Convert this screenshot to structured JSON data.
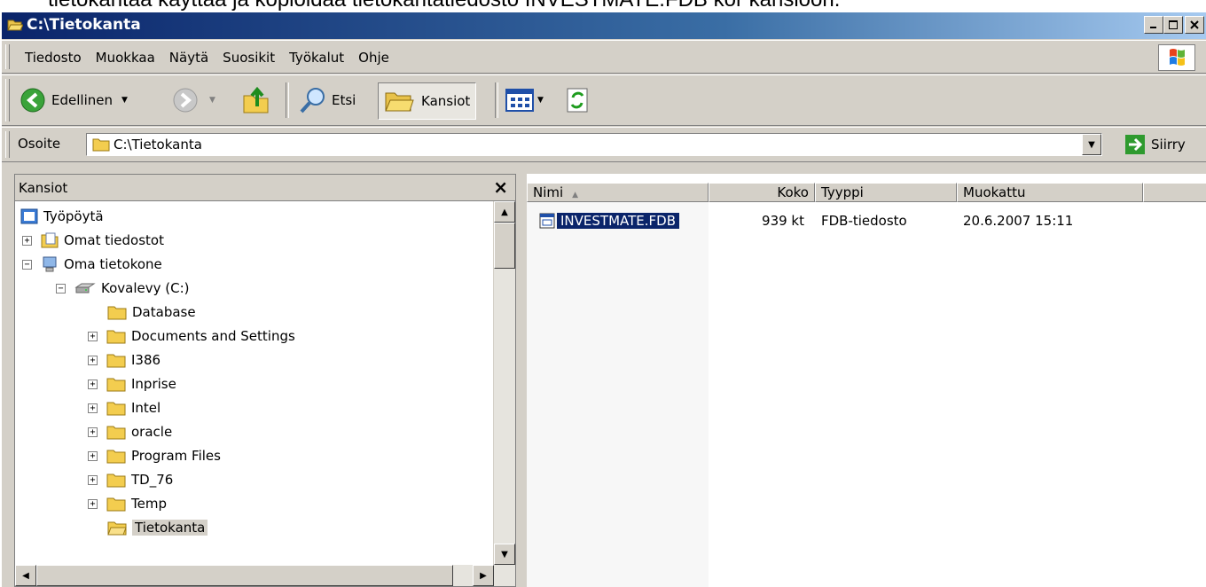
{
  "caption": "tietokantaa käyttää ja kopioidaa tietokantatiedosto INVESTMATE.FDB kor kansioon.",
  "window": {
    "title": "C:\\Tietokanta",
    "title_icon": "folder-open-icon"
  },
  "menu": [
    "Tiedosto",
    "Muokkaa",
    "Näytä",
    "Suosikit",
    "Työkalut",
    "Ohje"
  ],
  "toolbar": {
    "back": "Edellinen",
    "search": "Etsi",
    "folders": "Kansiot"
  },
  "address": {
    "label": "Osoite",
    "value": "C:\\Tietokanta",
    "go": "Siirry"
  },
  "folders_panel": {
    "title": "Kansiot",
    "close": "×",
    "tree": [
      {
        "label": "Työpöytä",
        "level": 0,
        "expander": "",
        "icon": "desktop-icon"
      },
      {
        "label": "Omat tiedostot",
        "level": 1,
        "expander": "+",
        "icon": "my-documents-icon"
      },
      {
        "label": "Oma tietokone",
        "level": 1,
        "expander": "−",
        "icon": "my-computer-icon"
      },
      {
        "label": "Kovalevy (C:)",
        "level": 2,
        "expander": "−",
        "icon": "hard-drive-icon"
      },
      {
        "label": "Database",
        "level": 3,
        "expander": "",
        "icon": "folder-icon"
      },
      {
        "label": "Documents and Settings",
        "level": 3,
        "expander": "+",
        "icon": "folder-icon"
      },
      {
        "label": "I386",
        "level": 3,
        "expander": "+",
        "icon": "folder-icon"
      },
      {
        "label": "Inprise",
        "level": 3,
        "expander": "+",
        "icon": "folder-icon"
      },
      {
        "label": "Intel",
        "level": 3,
        "expander": "+",
        "icon": "folder-icon"
      },
      {
        "label": "oracle",
        "level": 3,
        "expander": "+",
        "icon": "folder-icon"
      },
      {
        "label": "Program Files",
        "level": 3,
        "expander": "+",
        "icon": "folder-icon"
      },
      {
        "label": "TD_76",
        "level": 3,
        "expander": "+",
        "icon": "folder-icon"
      },
      {
        "label": "Temp",
        "level": 3,
        "expander": "+",
        "icon": "folder-icon"
      },
      {
        "label": "Tietokanta",
        "level": 3,
        "expander": "",
        "icon": "folder-open-icon",
        "selected": true
      }
    ]
  },
  "file_list": {
    "columns": [
      "Nimi",
      "Koko",
      "Tyyppi",
      "Muokattu"
    ],
    "rows": [
      {
        "name": "INVESTMATE.FDB",
        "size": "939 kt",
        "type": "FDB-tiedosto",
        "modified": "20.6.2007 15:11"
      }
    ]
  },
  "colors": {
    "title_start": "#0a246a",
    "title_end": "#a6caf0",
    "chrome": "#d4d0c8",
    "selection": "#0a246a"
  }
}
